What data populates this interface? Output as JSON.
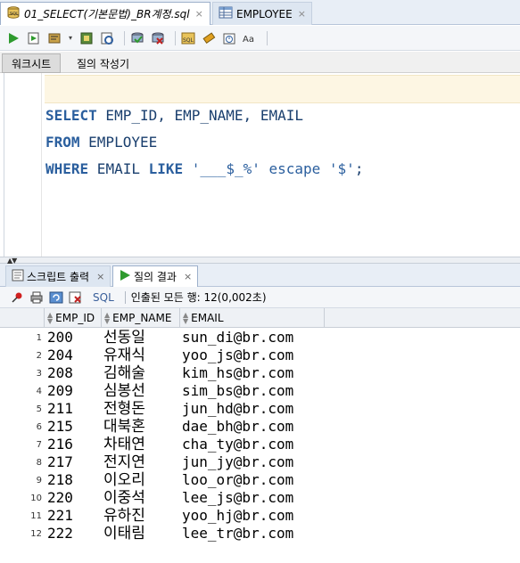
{
  "editor_tabs": [
    {
      "label": "01_SELECT(기본문법)_BR계정.sql",
      "icon": "sql-file-icon",
      "close": "×"
    },
    {
      "label": "EMPLOYEE",
      "icon": "table-icon",
      "close": "×"
    }
  ],
  "subtabs": {
    "worksheet": "워크시트",
    "query_builder": "질의 작성기"
  },
  "code": {
    "line1": {
      "kw1": "SELECT",
      "rest": " EMP_ID, EMP_NAME, EMAIL"
    },
    "line2": {
      "kw1": "FROM",
      "rest": " EMPLOYEE"
    },
    "line3": {
      "kw1": "WHERE",
      "mid": " EMAIL ",
      "kw2": "LIKE",
      "sp": " ",
      "str1": "'___$_%'",
      "mid2": " escape ",
      "str2": "'$'",
      "end": ";"
    }
  },
  "bottom_tabs": [
    {
      "label": "스크립트 출력",
      "icon": "script-output-icon",
      "close": "×"
    },
    {
      "label": "질의 결과",
      "icon": "run-icon",
      "close": "×"
    }
  ],
  "result_toolbar": {
    "sql_label": "SQL",
    "status": "인출된 모든 행: 12(0,002초)"
  },
  "grid": {
    "columns": [
      "EMP_ID",
      "EMP_NAME",
      "EMAIL"
    ],
    "rows": [
      {
        "n": "1",
        "emp_id": "200",
        "emp_name": "선동일",
        "email": "sun_di@br.com"
      },
      {
        "n": "2",
        "emp_id": "204",
        "emp_name": "유재식",
        "email": "yoo_js@br.com"
      },
      {
        "n": "3",
        "emp_id": "208",
        "emp_name": "김해술",
        "email": "kim_hs@br.com"
      },
      {
        "n": "4",
        "emp_id": "209",
        "emp_name": "심봉선",
        "email": "sim_bs@br.com"
      },
      {
        "n": "5",
        "emp_id": "211",
        "emp_name": "전형돈",
        "email": "jun_hd@br.com"
      },
      {
        "n": "6",
        "emp_id": "215",
        "emp_name": "대북혼",
        "email": "dae_bh@br.com"
      },
      {
        "n": "7",
        "emp_id": "216",
        "emp_name": "차태연",
        "email": "cha_ty@br.com"
      },
      {
        "n": "8",
        "emp_id": "217",
        "emp_name": "전지연",
        "email": "jun_jy@br.com"
      },
      {
        "n": "9",
        "emp_id": "218",
        "emp_name": "이오리",
        "email": "loo_or@br.com"
      },
      {
        "n": "10",
        "emp_id": "220",
        "emp_name": "이중석",
        "email": "lee_js@br.com"
      },
      {
        "n": "11",
        "emp_id": "221",
        "emp_name": "유하진",
        "email": "yoo_hj@br.com"
      },
      {
        "n": "12",
        "emp_id": "222",
        "emp_name": "이태림",
        "email": "lee_tr@br.com"
      }
    ]
  }
}
